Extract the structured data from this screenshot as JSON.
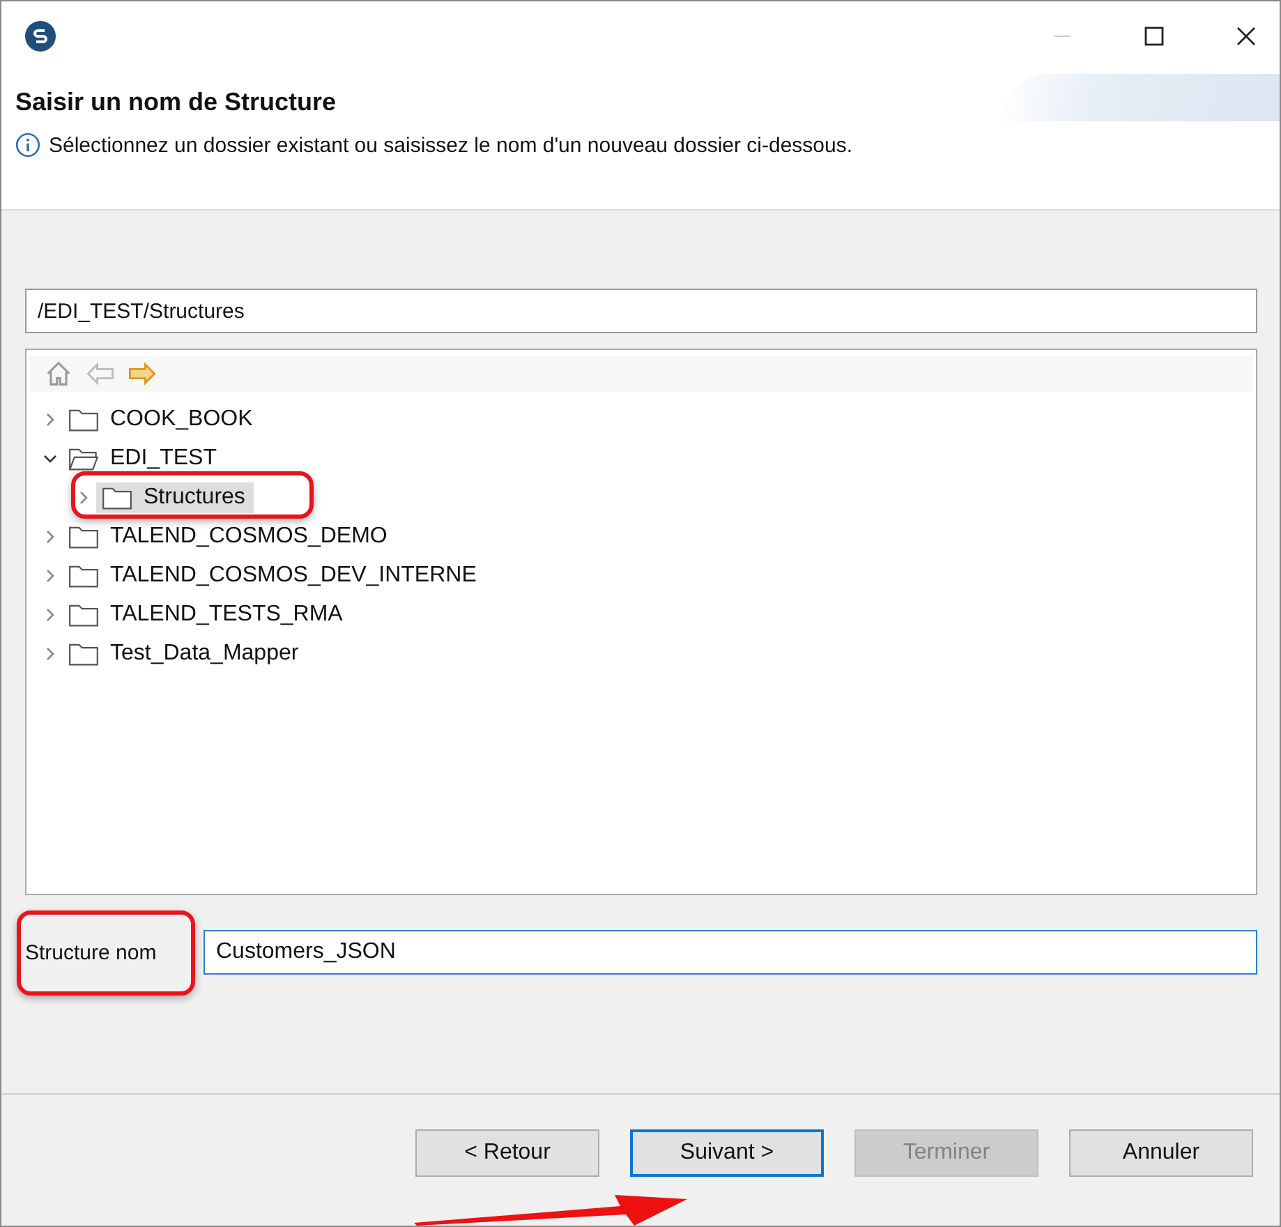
{
  "header": {
    "title": "Saisir un nom de Structure",
    "message": "Sélectionnez un dossier existant ou saisissez le nom d'un nouveau dossier ci-dessous."
  },
  "path_field": {
    "value": "/EDI_TEST/Structures"
  },
  "tree": [
    {
      "label": "COOK_BOOK",
      "expanded": false,
      "selected": false
    },
    {
      "label": "EDI_TEST",
      "expanded": true,
      "selected": false,
      "children": [
        {
          "label": "Structures",
          "expanded": false,
          "selected": true
        }
      ]
    },
    {
      "label": "TALEND_COSMOS_DEMO",
      "expanded": false,
      "selected": false
    },
    {
      "label": "TALEND_COSMOS_DEV_INTERNE",
      "expanded": false,
      "selected": false
    },
    {
      "label": "TALEND_TESTS_RMA",
      "expanded": false,
      "selected": false
    },
    {
      "label": "Test_Data_Mapper",
      "expanded": false,
      "selected": false
    }
  ],
  "name_field": {
    "label": "Structure nom",
    "value": "Customers_JSON"
  },
  "buttons": [
    {
      "label": "< Retour",
      "disabled": false,
      "default": false
    },
    {
      "label": "Suivant >",
      "disabled": false,
      "default": true
    },
    {
      "label": "Terminer",
      "disabled": true,
      "default": false
    },
    {
      "label": "Annuler",
      "disabled": false,
      "default": false
    }
  ]
}
